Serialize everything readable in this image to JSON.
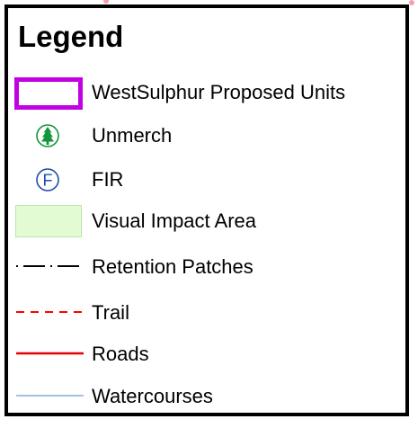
{
  "legend": {
    "title": "Legend",
    "items": [
      {
        "label": "WestSulphur Proposed Units",
        "symbol": "purple-outline-box-icon",
        "color": "#c100e3"
      },
      {
        "label": "Unmerch",
        "symbol": "green-tree-circle-icon",
        "color": "#11963b"
      },
      {
        "label": "FIR",
        "symbol": "blue-circle-f-icon",
        "color": "#1d4fa5"
      },
      {
        "label": "Visual Impact Area",
        "symbol": "light-green-fill-box-icon",
        "color": "#e3fbd2"
      },
      {
        "label": "Retention Patches",
        "symbol": "dash-dot-line-icon",
        "color": "#000000"
      },
      {
        "label": "Trail",
        "symbol": "red-dashed-line-icon",
        "color": "#ff0000"
      },
      {
        "label": "Roads",
        "symbol": "red-solid-line-icon",
        "color": "#e60000"
      },
      {
        "label": "Watercourses",
        "symbol": "blue-thin-line-icon",
        "color": "#4a7fd0"
      }
    ]
  },
  "fir_symbol_letter": "F"
}
